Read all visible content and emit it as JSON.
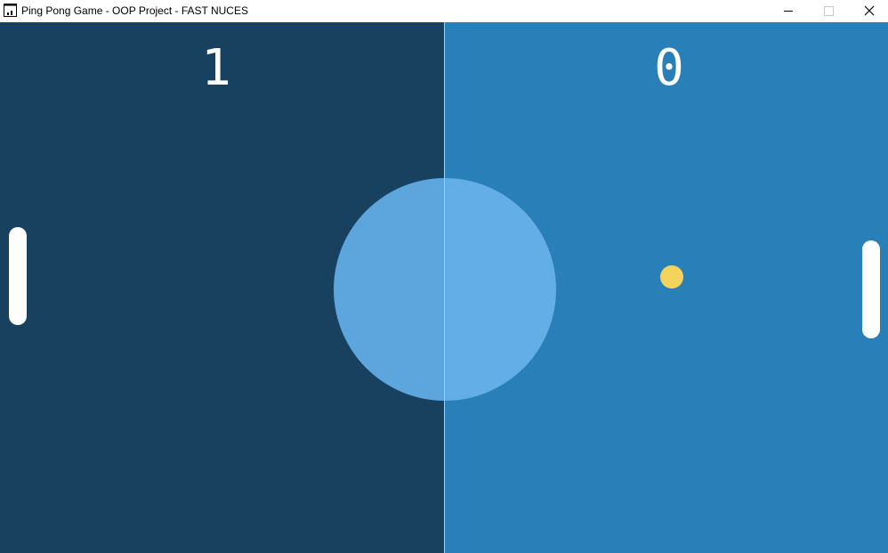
{
  "window": {
    "title": "Ping Pong Game - OOP Project - FAST NUCES",
    "icon": "app-window-icon",
    "controls": [
      "minimize-icon",
      "maximize-icon",
      "close-icon"
    ]
  },
  "game": {
    "scores": {
      "left": "1",
      "right": "0"
    },
    "colors": {
      "left_half": "#17415F",
      "right_half": "#2980B9",
      "circle_left": "#5CA5DD",
      "circle_right": "#63AEE6",
      "center_line": "#A7CDEA",
      "paddle": "#FFFFFF",
      "ball": "#F3D35B",
      "score": "#FFFFFF"
    }
  }
}
